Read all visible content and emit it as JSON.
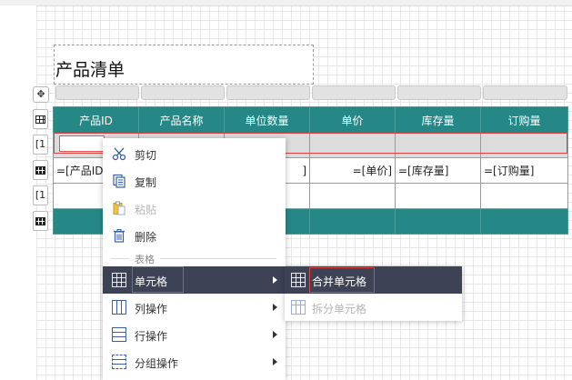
{
  "report": {
    "title": "产品清单",
    "columns": [
      "产品ID",
      "产品名称",
      "单位数量",
      "单价",
      "库存量",
      "订购量"
    ],
    "detail_row": [
      "=[产品ID",
      "",
      "]",
      "=[单价]",
      "=[库存量]",
      "=[订购量]"
    ]
  },
  "row_handles": [
    "",
    "[1",
    "",
    "[1",
    ""
  ],
  "context_menu": {
    "items": [
      {
        "label": "剪切",
        "icon": "scissors-icon",
        "enabled": true
      },
      {
        "label": "复制",
        "icon": "copy-icon",
        "enabled": true
      },
      {
        "label": "粘贴",
        "icon": "paste-icon",
        "enabled": false
      },
      {
        "label": "删除",
        "icon": "trash-icon",
        "enabled": true
      }
    ],
    "section_label": "表格",
    "table_items": [
      {
        "label": "单元格",
        "icon": "cell-grid-icon",
        "active": true
      },
      {
        "label": "列操作",
        "icon": "columns-icon",
        "active": false
      },
      {
        "label": "行操作",
        "icon": "rows-icon",
        "active": false
      },
      {
        "label": "分组操作",
        "icon": "group-icon",
        "active": false
      }
    ]
  },
  "submenu": {
    "items": [
      {
        "label": "合并单元格",
        "icon": "merge-cells-icon",
        "enabled": true
      },
      {
        "label": "拆分单元格",
        "icon": "split-cells-icon",
        "enabled": false
      }
    ]
  },
  "colors": {
    "header_bg": "#268787",
    "menu_active_bg": "#3d4355",
    "highlight_red": "#d94545"
  }
}
